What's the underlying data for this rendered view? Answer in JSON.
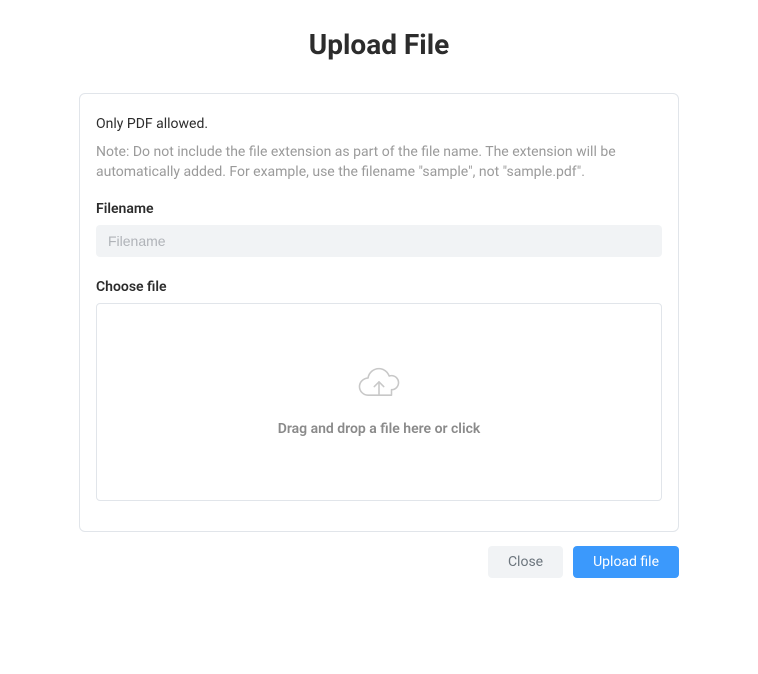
{
  "title": "Upload File",
  "card": {
    "allowed_text": "Only PDF allowed.",
    "note_text": "Note: Do not include the file extension as part of the file name. The extension will be automatically added. For example, use the filename \"sample\", not \"sample.pdf\".",
    "filename_label": "Filename",
    "filename_placeholder": "Filename",
    "filename_value": "",
    "choose_file_label": "Choose file",
    "dropzone_text": "Drag and drop a file here or click"
  },
  "actions": {
    "close_label": "Close",
    "upload_label": "Upload file"
  },
  "colors": {
    "primary": "#3b99fc",
    "secondary_bg": "#f1f3f5",
    "border": "#e1e5ea",
    "muted_text": "#9a9a9a"
  }
}
